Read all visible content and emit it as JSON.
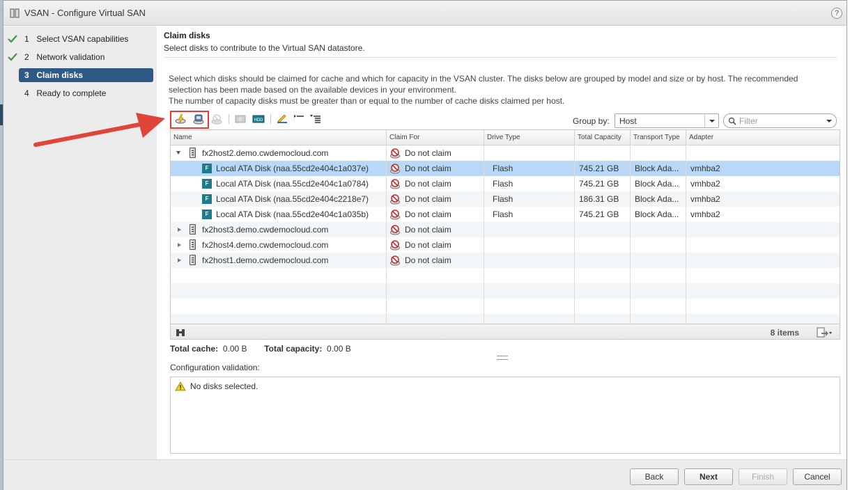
{
  "window": {
    "title": "VSAN - Configure Virtual SAN",
    "help_label": "?"
  },
  "steps": [
    {
      "num": "1",
      "label": "Select VSAN capabilities",
      "done": true
    },
    {
      "num": "2",
      "label": "Network validation",
      "done": true
    },
    {
      "num": "3",
      "label": "Claim disks",
      "done": false,
      "active": true
    },
    {
      "num": "4",
      "label": "Ready to complete",
      "done": false
    }
  ],
  "header": {
    "title": "Claim disks",
    "subtitle": "Select disks to contribute to the Virtual SAN datastore."
  },
  "description": {
    "line1": "Select which disks should be claimed for cache and which for capacity in the VSAN cluster. The disks below are grouped by model and size or by host. The recommended",
    "line2": "selection has been made based on the available devices in your environment.",
    "line3": "The number of capacity disks must be greater than or equal to the number of cache disks claimed per host."
  },
  "toolbar": {
    "icons": [
      "claim-cache-icon",
      "claim-capacity-icon",
      "do-not-claim-icon",
      "flash-mark-icon",
      "hdd-mark-icon",
      "edit-icon",
      "collapse-all-icon",
      "expand-all-icon"
    ],
    "group_by_label": "Group by:",
    "group_by_value": "Host",
    "filter_placeholder": "Filter"
  },
  "table": {
    "columns": [
      "Name",
      "Claim For",
      "Drive Type",
      "Total Capacity",
      "Transport Type",
      "Adapter"
    ],
    "rows": [
      {
        "kind": "host",
        "expanded": true,
        "name": "fx2host2.demo.cwdemocloud.com",
        "claim": "Do not claim",
        "drive": "",
        "capacity": "",
        "transport": "",
        "adapter": ""
      },
      {
        "kind": "disk",
        "selected": true,
        "name": "Local ATA Disk (naa.55cd2e404c1a037e)",
        "claim": "Do not claim",
        "drive": "Flash",
        "capacity": "745.21 GB",
        "transport": "Block Ada...",
        "adapter": "vmhba2"
      },
      {
        "kind": "disk",
        "name": "Local ATA Disk (naa.55cd2e404c1a0784)",
        "claim": "Do not claim",
        "drive": "Flash",
        "capacity": "745.21 GB",
        "transport": "Block Ada...",
        "adapter": "vmhba2"
      },
      {
        "kind": "disk",
        "name": "Local ATA Disk (naa.55cd2e404c2218e7)",
        "claim": "Do not claim",
        "drive": "Flash",
        "capacity": "186.31 GB",
        "transport": "Block Ada...",
        "adapter": "vmhba2"
      },
      {
        "kind": "disk",
        "name": "Local ATA Disk (naa.55cd2e404c1a035b)",
        "claim": "Do not claim",
        "drive": "Flash",
        "capacity": "745.21 GB",
        "transport": "Block Ada...",
        "adapter": "vmhba2"
      },
      {
        "kind": "host",
        "expanded": false,
        "name": "fx2host3.demo.cwdemocloud.com",
        "claim": "Do not claim",
        "drive": "",
        "capacity": "",
        "transport": "",
        "adapter": ""
      },
      {
        "kind": "host",
        "expanded": false,
        "name": "fx2host4.demo.cwdemocloud.com",
        "claim": "Do not claim",
        "drive": "",
        "capacity": "",
        "transport": "",
        "adapter": ""
      },
      {
        "kind": "host",
        "expanded": false,
        "name": "fx2host1.demo.cwdemocloud.com",
        "claim": "Do not claim",
        "drive": "",
        "capacity": "",
        "transport": "",
        "adapter": ""
      }
    ],
    "item_count": "8 items",
    "disk_badge": "F"
  },
  "totals": {
    "cache_label": "Total cache:",
    "cache_value": "0.00 B",
    "capacity_label": "Total capacity:",
    "capacity_value": "0.00 B"
  },
  "validation": {
    "label": "Configuration validation:",
    "message": "No disks selected."
  },
  "buttons": {
    "back": "Back",
    "next": "Next",
    "finish": "Finish",
    "cancel": "Cancel"
  },
  "colors": {
    "accent": "#2f5a85",
    "selected_row": "#b7d9f7",
    "annotation": "#e03c31",
    "check": "#3c9a3c"
  }
}
